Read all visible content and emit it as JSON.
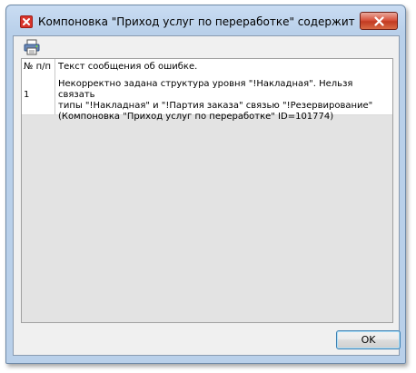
{
  "window": {
    "title": "Компоновка \"Приход услуг по переработке\" содержит оши...",
    "title_icon": "error-icon",
    "close_icon": "close-icon"
  },
  "toolbar": {
    "print_icon": "printer-icon"
  },
  "grid": {
    "columns": [
      "№ п/п",
      "Текст сообщения об ошибке."
    ],
    "rows": [
      {
        "num": "1",
        "text": "Некорректно задана структура уровня \"!Накладная\". Нельзя связать\nтипы \"!Накладная\" и \"!Партия заказа\" связью \"!Резервирование\"\n(Компоновка \"Приход услуг по переработке\" ID=101774)"
      }
    ]
  },
  "footer": {
    "ok_label": "OK"
  },
  "colors": {
    "frame": "#b9d0ea",
    "close_button": "#c23a22",
    "client_bg": "#f0f0f0"
  }
}
